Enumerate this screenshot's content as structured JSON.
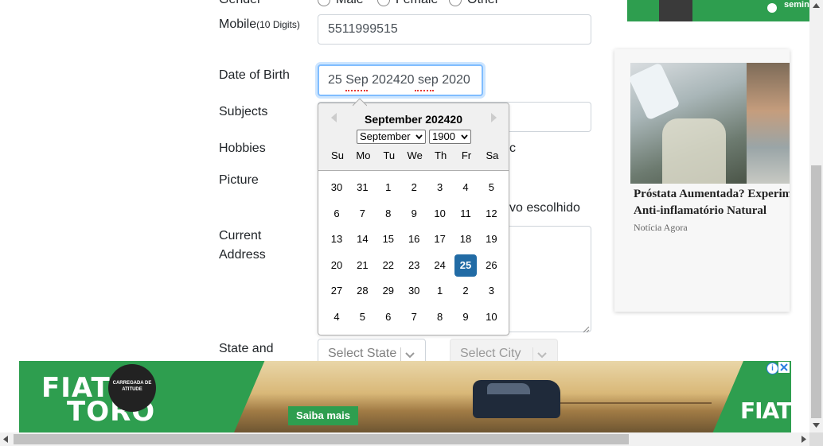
{
  "form": {
    "gender_label": "Gender",
    "gender_options": [
      "Male",
      "Female",
      "Other"
    ],
    "mobile_label": "Mobile",
    "mobile_hint": "(10 Digits)",
    "mobile_value": "5511999515",
    "dob_label": "Date of Birth",
    "dob_value": "25 Sep 202420 sep 2020",
    "subjects_label": "Subjects",
    "hobbies_label": "Hobbies",
    "hobbies_partial": "c",
    "picture_label": "Picture",
    "picture_status_partial": "vo escolhido",
    "address_label_1": "Current",
    "address_label_2": "Address",
    "state_label": "State and",
    "state_placeholder": "Select State",
    "city_placeholder": "Select City"
  },
  "datepicker": {
    "title": "September 202420",
    "month_select": "September",
    "year_select": "1900",
    "day_names": [
      "Su",
      "Mo",
      "Tu",
      "We",
      "Th",
      "Fr",
      "Sa"
    ],
    "weeks": [
      [
        "30",
        "31",
        "1",
        "2",
        "3",
        "4",
        "5"
      ],
      [
        "6",
        "7",
        "8",
        "9",
        "10",
        "11",
        "12"
      ],
      [
        "13",
        "14",
        "15",
        "16",
        "17",
        "18",
        "19"
      ],
      [
        "20",
        "21",
        "22",
        "23",
        "24",
        "25",
        "26"
      ],
      [
        "27",
        "28",
        "29",
        "30",
        "1",
        "2",
        "3"
      ],
      [
        "4",
        "5",
        "6",
        "7",
        "8",
        "9",
        "10"
      ]
    ],
    "selected_day": "25",
    "selected_color": "#216ba5"
  },
  "side_ad": {
    "top_banner_text": "semin",
    "headline_line1": "Próstata Aumentada? Experimen",
    "headline_line2": "Anti-inflamatório Natural",
    "source": "Notícia Agora"
  },
  "bottom_ad": {
    "brand_line1": "FIAT",
    "brand_line2": "TORO",
    "badge_text": "CARREGADA DE ATITUDE",
    "cta": "Saiba mais",
    "logo": "FIAT",
    "brand_color": "#2e9e4f"
  }
}
